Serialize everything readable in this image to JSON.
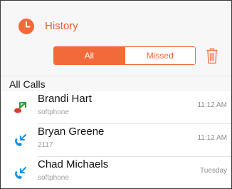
{
  "header": {
    "title": "History",
    "icon": "clock-icon",
    "accent_color": "#f26a3a"
  },
  "filter": {
    "all_label": "All",
    "missed_label": "Missed",
    "selected": "All"
  },
  "trash_icon": "trash-icon",
  "section": {
    "title": "All Calls"
  },
  "calls": [
    {
      "name": "Brandi Hart",
      "detail": "softphone",
      "time": "11:12 AM",
      "type": "missed",
      "icon": "missed-call-icon"
    },
    {
      "name": "Bryan Greene",
      "detail": "2117",
      "time": "11:12 AM",
      "type": "incoming",
      "icon": "incoming-call-icon"
    },
    {
      "name": "Chad Michaels",
      "detail": "softphone",
      "time": "Tuesday",
      "type": "incoming",
      "icon": "incoming-call-icon"
    }
  ]
}
